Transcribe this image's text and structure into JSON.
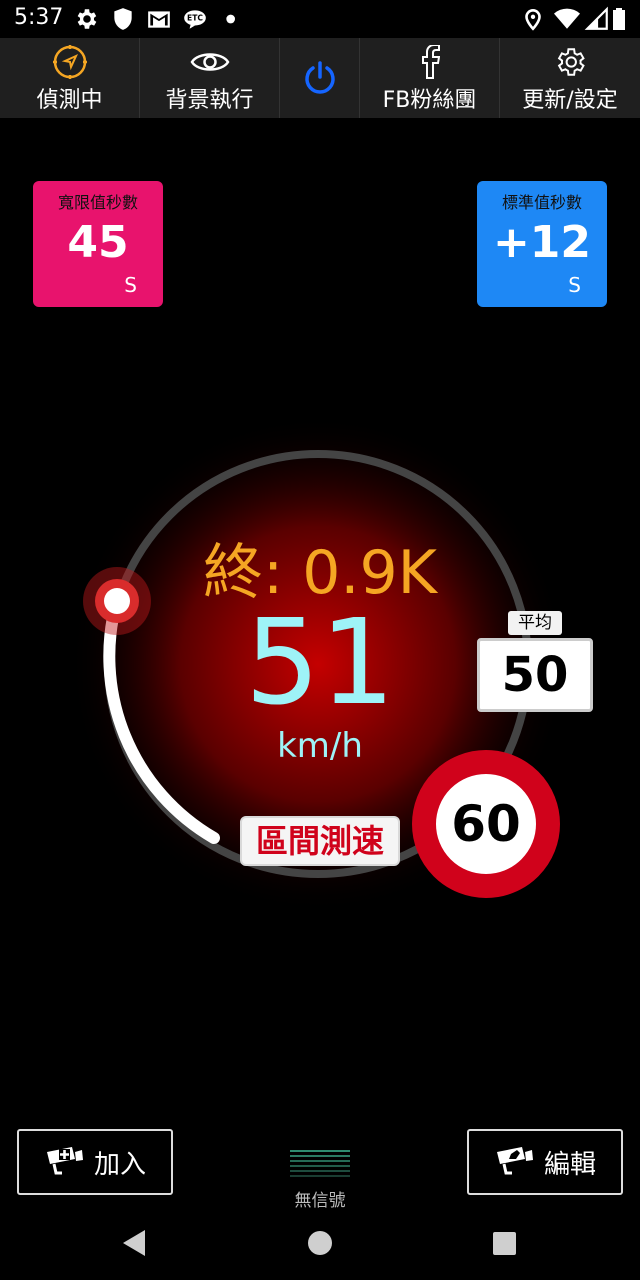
{
  "status_bar": {
    "time": "5:37",
    "left_icons": [
      "gear-icon",
      "shield-icon",
      "gmail-icon",
      "etc-icon",
      "dot-icon"
    ],
    "right_icons": [
      "location-icon",
      "wifi-icon",
      "signal-icon",
      "battery-icon"
    ]
  },
  "toolbar": {
    "items": [
      {
        "label": "偵測中",
        "icon": "compass-icon",
        "color": "#f5a623"
      },
      {
        "label": "背景執行",
        "icon": "eye-icon",
        "color": "#ffffff"
      },
      {
        "label": "",
        "icon": "power-icon",
        "color": "#1565ff"
      },
      {
        "label": "FB粉絲團",
        "icon": "facebook-icon",
        "color": "#ffffff"
      },
      {
        "label": "更新/設定",
        "icon": "gear-icon",
        "color": "#ffffff"
      }
    ]
  },
  "grace_seconds": {
    "title": "寬限值秒數",
    "value": "45",
    "unit": "S",
    "color": "#e8136d"
  },
  "standard_seconds": {
    "title": "標準值秒數",
    "value": "+12",
    "unit": "S",
    "color": "#1e88f5"
  },
  "gauge": {
    "remaining": "終: 0.9K",
    "speed": "51",
    "unit": "km/h",
    "avg_label": "平均",
    "avg_value": "50",
    "zone_label": "區間測速",
    "speed_limit": "60"
  },
  "bottom": {
    "add_label": "加入",
    "edit_label": "編輯",
    "signal_label": "無信號"
  }
}
